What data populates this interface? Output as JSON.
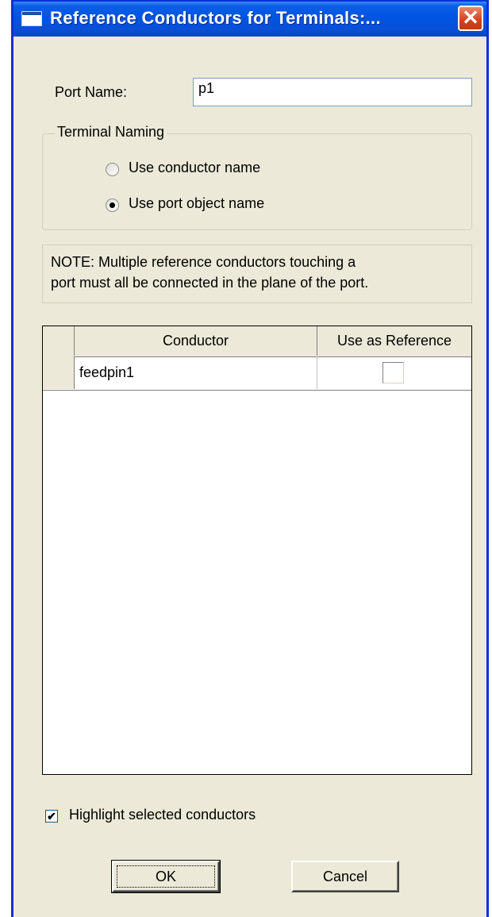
{
  "window": {
    "title": "Reference Conductors for Terminals:...",
    "close_glyph": "✕"
  },
  "port": {
    "label": "Port Name:",
    "value": "p1"
  },
  "terminal_naming": {
    "legend": "Terminal Naming",
    "options": [
      {
        "label": "Use conductor name",
        "checked": false
      },
      {
        "label": "Use port object name",
        "checked": true
      }
    ]
  },
  "note": {
    "line1": "NOTE: Multiple reference conductors touching a",
    "line2": "port must all be connected in the plane of the port."
  },
  "table": {
    "columns": [
      "Conductor",
      "Use as Reference"
    ],
    "rows": [
      {
        "conductor": "feedpin1",
        "use_as_reference": false
      }
    ]
  },
  "highlight": {
    "label": "Highlight selected conductors",
    "checked": true,
    "glyph": "✔"
  },
  "buttons": {
    "ok": "OK",
    "cancel": "Cancel"
  }
}
